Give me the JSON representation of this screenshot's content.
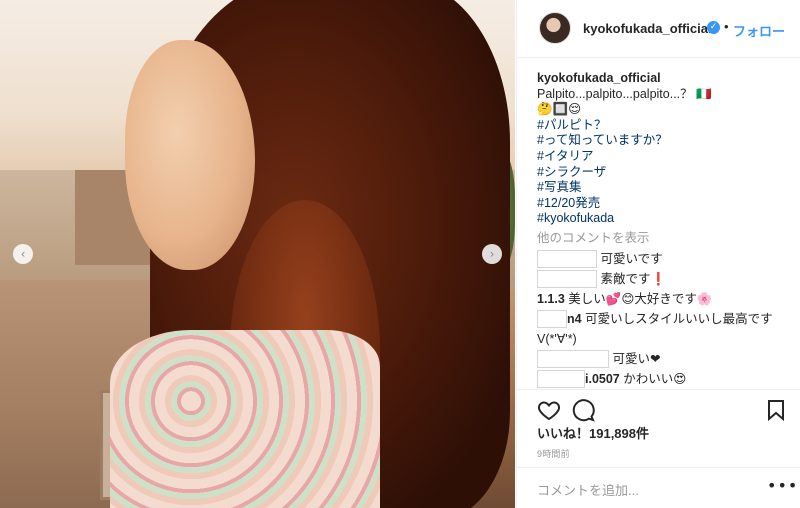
{
  "post": {
    "username": "kyokofukada_official",
    "dot": "•",
    "follow_label": "フォロー",
    "verified_glyph": "✓",
    "nav_prev": "‹",
    "nav_next": "›"
  },
  "caption": {
    "text": "Palpito...palpito...palpito...？",
    "flag": "🇮🇹",
    "emojis": "🤔🔲😌",
    "hashtags": [
      "#パルピト？",
      "#って知っていますか？",
      "#イタリア",
      "#シラクーザ",
      "#写真集",
      "#12/20発売",
      "#kyokofukada"
    ]
  },
  "view_more_label": "他のコメントを表示",
  "comments": [
    {
      "user": "",
      "text": "可愛いです"
    },
    {
      "user": "",
      "text": "素敵です❗"
    },
    {
      "user": "1.1.3",
      "text": "美しい💕😊大好きです🌸"
    },
    {
      "user": "n4",
      "text": "可愛いしスタイルいいし最高です"
    },
    {
      "user": "",
      "text": "V(*'∀'*)"
    },
    {
      "user": "",
      "text": "可愛い❤"
    },
    {
      "user": "i.0507",
      "text": "かわいい😍"
    }
  ],
  "icons": {
    "heart": "heart-icon",
    "comment": "comment-icon",
    "save": "bookmark-icon"
  },
  "likes": "いいね！191,898件",
  "timestamp": "9時間前",
  "add_comment_placeholder": "コメントを追加...",
  "more_options": "•••",
  "colors": {
    "link": "#003569",
    "accent": "#3897f0",
    "muted": "#999999"
  }
}
